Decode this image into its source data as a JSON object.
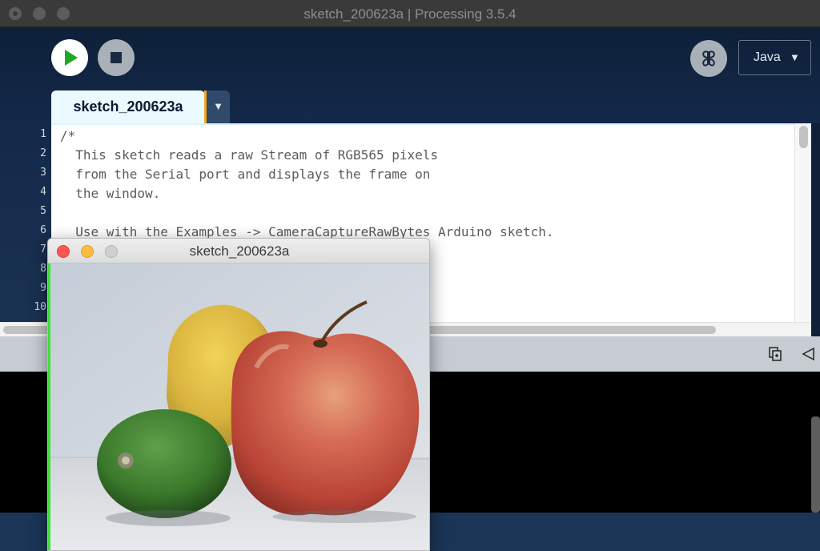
{
  "window": {
    "title": "sketch_200623a | Processing 3.5.4"
  },
  "toolbar": {
    "mode_label": "Java",
    "mode_arrow": "▼"
  },
  "tabs": [
    {
      "label": "sketch_200623a",
      "menu_arrow": "▼"
    }
  ],
  "editor": {
    "line_numbers": [
      "1",
      "2",
      "3",
      "4",
      "5",
      "6",
      "7",
      "8",
      "9",
      "10"
    ],
    "lines": [
      "/*",
      "  This sketch reads a raw Stream of RGB565 pixels",
      "  from the Serial port and displays the frame on",
      "  the window.",
      "",
      "  Use with the Examples -> CameraCaptureRawBytes Arduino sketch."
    ]
  },
  "sketch_window": {
    "title": "sketch_200623a"
  },
  "colors": {
    "accent_tab": "#f5a623",
    "run_green": "#1fa823",
    "background": "#0f2038"
  }
}
